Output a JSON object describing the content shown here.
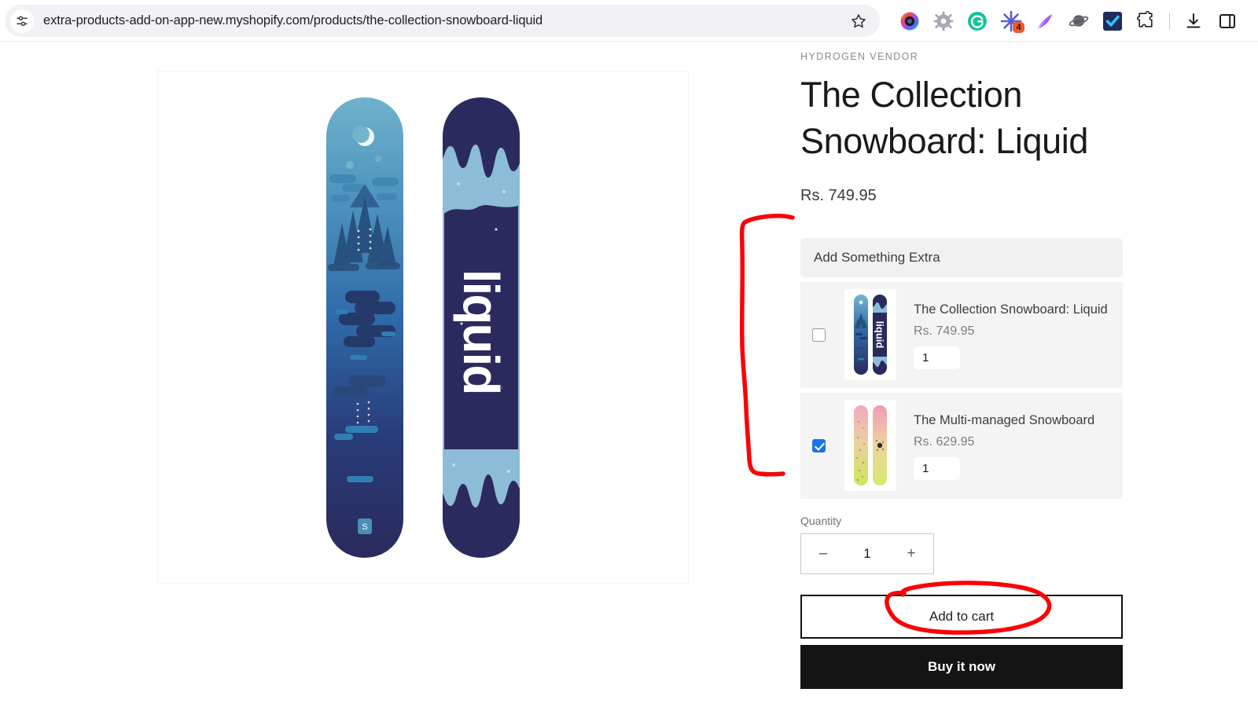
{
  "browser": {
    "url": "extra-products-add-on-app-new.myshopify.com/products/the-collection-snowboard-liquid",
    "site_info_icon": "tune-sliders-icon",
    "bookmark_icon": "star-outline-icon",
    "extensions": [
      {
        "name": "camera-lens-icon",
        "badge": ""
      },
      {
        "name": "gear-icon",
        "badge": ""
      },
      {
        "name": "grammarly-g-icon",
        "badge": ""
      },
      {
        "name": "burst-sparkle-icon",
        "badge": "4"
      },
      {
        "name": "pen-quill-icon",
        "badge": ""
      },
      {
        "name": "planet-icon",
        "badge": ""
      },
      {
        "name": "blue-checkmark-icon",
        "badge": ""
      },
      {
        "name": "puzzle-piece-extensions-icon",
        "badge": ""
      }
    ],
    "downloads_icon": "download-arrow-icon",
    "side_panel_icon": "side-panel-icon"
  },
  "product": {
    "vendor": "HYDROGEN VENDOR",
    "title": "The Collection Snowboard: Liquid",
    "price": "Rs. 749.95",
    "gallery_alt": "snowboard-pair-liquid"
  },
  "addon_widget": {
    "header_label": "Add Something Extra",
    "items": [
      {
        "name": "The Collection Snowboard: Liquid",
        "price": "Rs. 749.95",
        "quantity": "1",
        "checked": false,
        "thumb": "snowboard-liquid-blue"
      },
      {
        "name": "The Multi-managed Snowboard",
        "price": "Rs. 629.95",
        "quantity": "1",
        "checked": true,
        "thumb": "snowboard-multimanaged-pink"
      }
    ]
  },
  "quantity": {
    "label": "Quantity",
    "value": "1",
    "decrease_label": "–",
    "increase_label": "+"
  },
  "actions": {
    "add_to_cart_label": "Add to cart",
    "buy_it_now_label": "Buy it now"
  },
  "annotations": {
    "color": "#fb0007",
    "bracket_name": "red-bracket-around-addon-widget",
    "ellipse_name": "red-ellipse-around-add-to-cart"
  },
  "colors": {
    "accent_checkbox": "#1a73e8",
    "widget_bg": "#f1f1f1",
    "item_bg": "#f4f4f4",
    "cta_dark": "#141414",
    "annotation_red": "#fb0007"
  }
}
